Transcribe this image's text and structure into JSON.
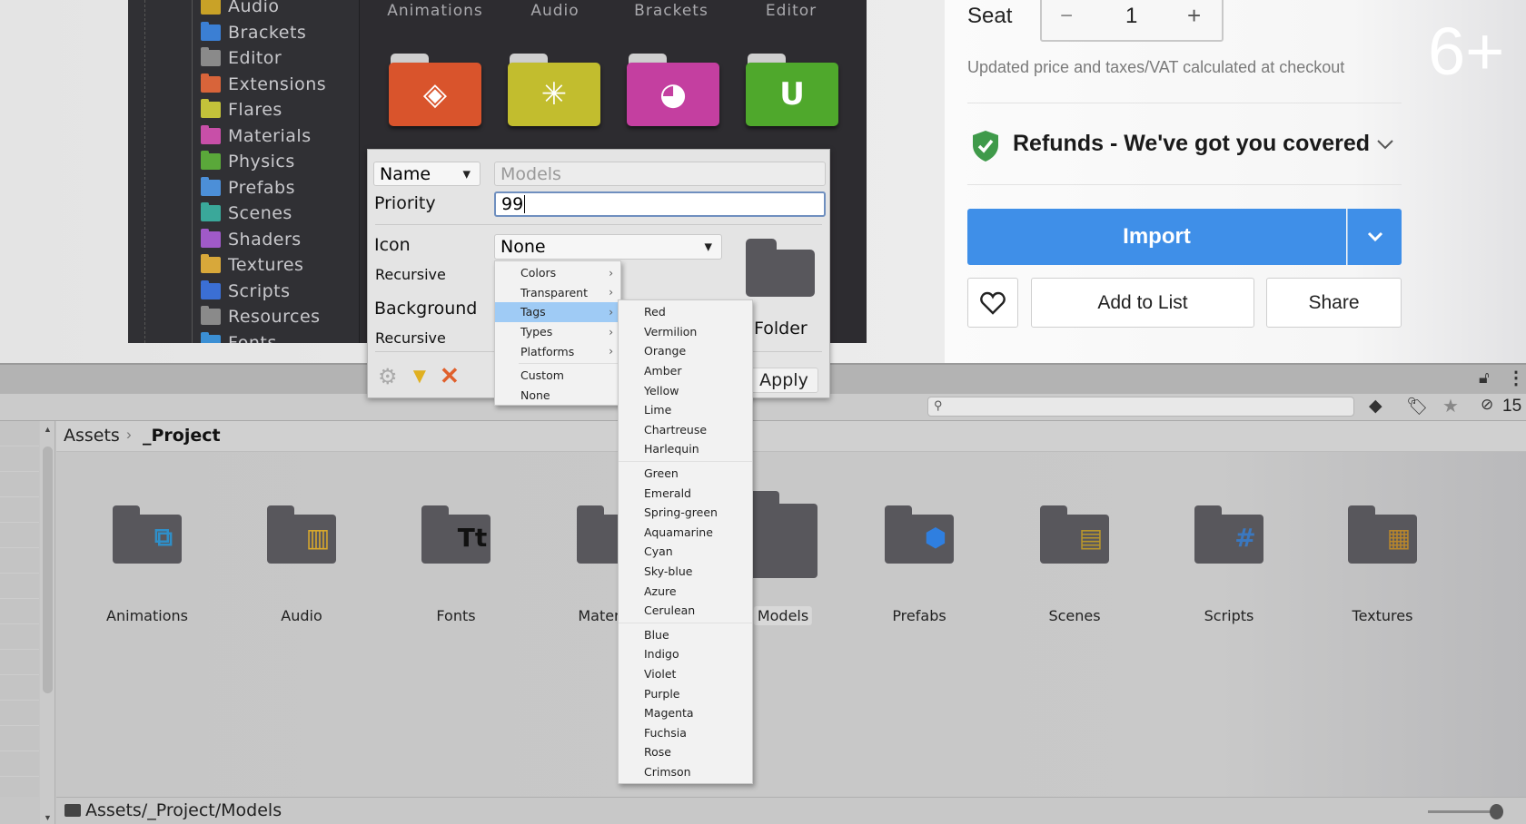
{
  "unity_preview": {
    "tree_items": [
      {
        "label": "Audio",
        "color": "#c9a227"
      },
      {
        "label": "Brackets",
        "color": "#3b7fd4"
      },
      {
        "label": "Editor",
        "color": "#8a8a8a"
      },
      {
        "label": "Extensions",
        "color": "#d8643a"
      },
      {
        "label": "Flares",
        "color": "#c3c23a"
      },
      {
        "label": "Materials",
        "color": "#c84fa8"
      },
      {
        "label": "Physics",
        "color": "#5aa83a"
      },
      {
        "label": "Prefabs",
        "color": "#4c8fd8"
      },
      {
        "label": "Scenes",
        "color": "#3aa89a"
      },
      {
        "label": "Shaders",
        "color": "#a05ac8"
      },
      {
        "label": "Textures",
        "color": "#d8a83a"
      },
      {
        "label": "Scripts",
        "color": "#3b6fd4"
      },
      {
        "label": "Resources",
        "color": "#8a8a8a"
      },
      {
        "label": "Fonts",
        "color": "#3b8fd4"
      }
    ],
    "folder_headers": [
      "Animations",
      "Audio",
      "Brackets",
      "Editor"
    ],
    "colored_folders": [
      {
        "color": "#d9542c",
        "icon": "diamond-plus-icon",
        "glyph": "◈"
      },
      {
        "color": "#c2bd2e",
        "icon": "flare-icon",
        "glyph": "✳"
      },
      {
        "color": "#c43fa0",
        "icon": "material-ball-icon",
        "glyph": "◕"
      },
      {
        "color": "#4fa82c",
        "icon": "magnet-icon",
        "glyph": "U"
      }
    ]
  },
  "dialog": {
    "name_dropdown": "Name",
    "name_value": "Models",
    "priority_label": "Priority",
    "priority_value": "99",
    "icon_label": "Icon",
    "icon_value": "None",
    "recursive_label": "Recursive",
    "background_label": "Background",
    "recursive2_label": "Recursive",
    "preview_label": "Folder",
    "apply": "Apply"
  },
  "icon_menu": {
    "items": [
      {
        "label": "Colors",
        "submenu": true
      },
      {
        "label": "Transparent",
        "submenu": true
      },
      {
        "label": "Tags",
        "submenu": true,
        "highlighted": true
      },
      {
        "label": "Types",
        "submenu": true
      },
      {
        "label": "Platforms",
        "submenu": true
      }
    ],
    "items2": [
      {
        "label": "Custom"
      },
      {
        "label": "None"
      }
    ]
  },
  "tag_menu": {
    "groups": [
      [
        "Red",
        "Vermilion",
        "Orange",
        "Amber",
        "Yellow",
        "Lime",
        "Chartreuse",
        "Harlequin"
      ],
      [
        "Green",
        "Emerald",
        "Spring-green",
        "Aquamarine",
        "Cyan",
        "Sky-blue",
        "Azure",
        "Cerulean"
      ],
      [
        "Blue",
        "Indigo",
        "Violet",
        "Purple",
        "Magenta",
        "Fuchsia",
        "Rose",
        "Crimson"
      ]
    ]
  },
  "store": {
    "seat_label": "Seat",
    "seat_minus": "−",
    "seat_value": "1",
    "seat_plus": "+",
    "price_note": "Updated price and taxes/VAT calculated at checkout",
    "refunds": "Refunds - We've got you covered",
    "import": "Import",
    "add_to_list": "Add to List",
    "share": "Share",
    "watermark": "6+",
    "accent": "#3f8fe8",
    "shield_color": "#3f9a4a"
  },
  "project": {
    "hidden_count": "15",
    "breadcrumb": [
      "Assets",
      "_Project"
    ],
    "folders": [
      {
        "label": "Animations",
        "icon": "animation-icon",
        "glyph": "⧉",
        "color": "#2f8fc8"
      },
      {
        "label": "Audio",
        "icon": "audio-icon",
        "glyph": "▥",
        "color": "#d8a82c"
      },
      {
        "label": "Fonts",
        "icon": "font-icon",
        "glyph": "Tt",
        "color": "#111"
      },
      {
        "label": "Materials",
        "icon": "material-icon",
        "glyph": "●",
        "color": "#3b7fd4"
      },
      {
        "label": "Models",
        "icon": "",
        "glyph": "",
        "color": ""
      },
      {
        "label": "Prefabs",
        "icon": "prefab-cube-icon",
        "glyph": "⬢",
        "color": "#2f7fe0"
      },
      {
        "label": "Scenes",
        "icon": "scene-icon",
        "glyph": "▤",
        "color": "#b8962c"
      },
      {
        "label": "Scripts",
        "icon": "script-hash-icon",
        "glyph": "#",
        "color": "#3a78c0"
      },
      {
        "label": "Textures",
        "icon": "texture-checker-icon",
        "glyph": "▦",
        "color": "#b8862c"
      }
    ],
    "status_path": "Assets/_Project/Models"
  }
}
